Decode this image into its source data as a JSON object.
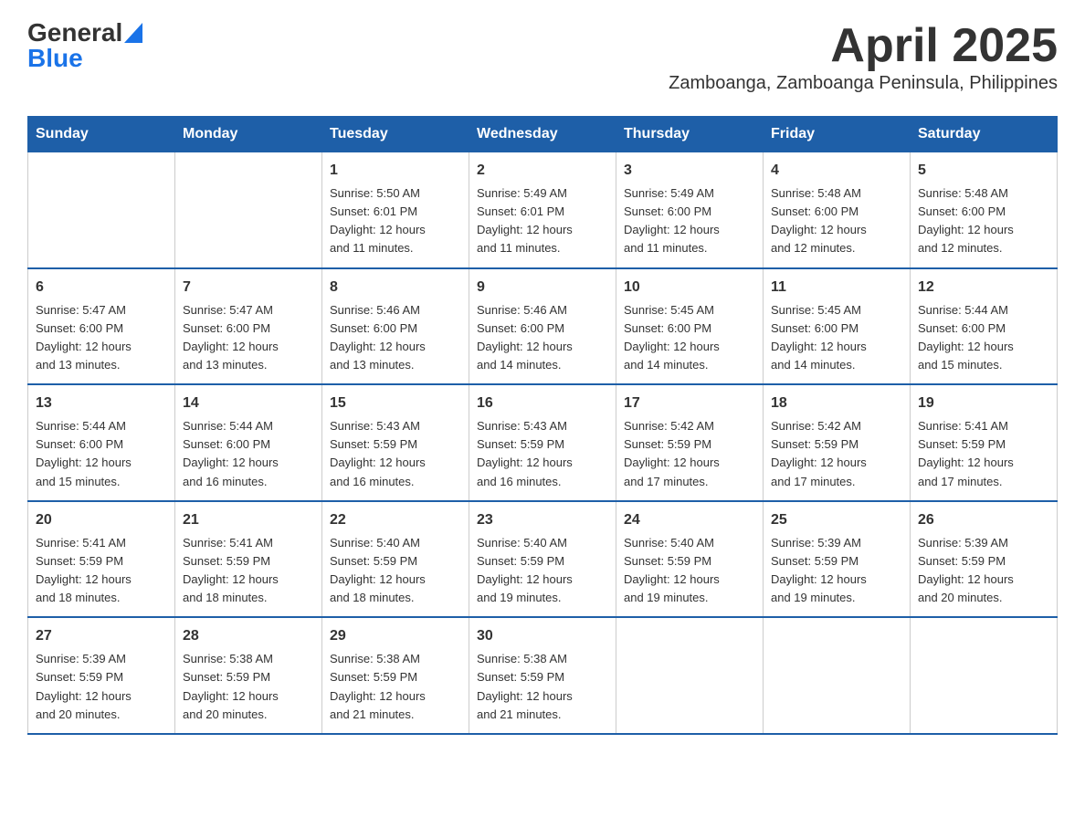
{
  "header": {
    "logo_general": "General",
    "logo_blue": "Blue",
    "title": "April 2025",
    "subtitle": "Zamboanga, Zamboanga Peninsula, Philippines"
  },
  "days_of_week": [
    "Sunday",
    "Monday",
    "Tuesday",
    "Wednesday",
    "Thursday",
    "Friday",
    "Saturday"
  ],
  "weeks": [
    [
      {
        "day": "",
        "info": ""
      },
      {
        "day": "",
        "info": ""
      },
      {
        "day": "1",
        "info": "Sunrise: 5:50 AM\nSunset: 6:01 PM\nDaylight: 12 hours\nand 11 minutes."
      },
      {
        "day": "2",
        "info": "Sunrise: 5:49 AM\nSunset: 6:01 PM\nDaylight: 12 hours\nand 11 minutes."
      },
      {
        "day": "3",
        "info": "Sunrise: 5:49 AM\nSunset: 6:00 PM\nDaylight: 12 hours\nand 11 minutes."
      },
      {
        "day": "4",
        "info": "Sunrise: 5:48 AM\nSunset: 6:00 PM\nDaylight: 12 hours\nand 12 minutes."
      },
      {
        "day": "5",
        "info": "Sunrise: 5:48 AM\nSunset: 6:00 PM\nDaylight: 12 hours\nand 12 minutes."
      }
    ],
    [
      {
        "day": "6",
        "info": "Sunrise: 5:47 AM\nSunset: 6:00 PM\nDaylight: 12 hours\nand 13 minutes."
      },
      {
        "day": "7",
        "info": "Sunrise: 5:47 AM\nSunset: 6:00 PM\nDaylight: 12 hours\nand 13 minutes."
      },
      {
        "day": "8",
        "info": "Sunrise: 5:46 AM\nSunset: 6:00 PM\nDaylight: 12 hours\nand 13 minutes."
      },
      {
        "day": "9",
        "info": "Sunrise: 5:46 AM\nSunset: 6:00 PM\nDaylight: 12 hours\nand 14 minutes."
      },
      {
        "day": "10",
        "info": "Sunrise: 5:45 AM\nSunset: 6:00 PM\nDaylight: 12 hours\nand 14 minutes."
      },
      {
        "day": "11",
        "info": "Sunrise: 5:45 AM\nSunset: 6:00 PM\nDaylight: 12 hours\nand 14 minutes."
      },
      {
        "day": "12",
        "info": "Sunrise: 5:44 AM\nSunset: 6:00 PM\nDaylight: 12 hours\nand 15 minutes."
      }
    ],
    [
      {
        "day": "13",
        "info": "Sunrise: 5:44 AM\nSunset: 6:00 PM\nDaylight: 12 hours\nand 15 minutes."
      },
      {
        "day": "14",
        "info": "Sunrise: 5:44 AM\nSunset: 6:00 PM\nDaylight: 12 hours\nand 16 minutes."
      },
      {
        "day": "15",
        "info": "Sunrise: 5:43 AM\nSunset: 5:59 PM\nDaylight: 12 hours\nand 16 minutes."
      },
      {
        "day": "16",
        "info": "Sunrise: 5:43 AM\nSunset: 5:59 PM\nDaylight: 12 hours\nand 16 minutes."
      },
      {
        "day": "17",
        "info": "Sunrise: 5:42 AM\nSunset: 5:59 PM\nDaylight: 12 hours\nand 17 minutes."
      },
      {
        "day": "18",
        "info": "Sunrise: 5:42 AM\nSunset: 5:59 PM\nDaylight: 12 hours\nand 17 minutes."
      },
      {
        "day": "19",
        "info": "Sunrise: 5:41 AM\nSunset: 5:59 PM\nDaylight: 12 hours\nand 17 minutes."
      }
    ],
    [
      {
        "day": "20",
        "info": "Sunrise: 5:41 AM\nSunset: 5:59 PM\nDaylight: 12 hours\nand 18 minutes."
      },
      {
        "day": "21",
        "info": "Sunrise: 5:41 AM\nSunset: 5:59 PM\nDaylight: 12 hours\nand 18 minutes."
      },
      {
        "day": "22",
        "info": "Sunrise: 5:40 AM\nSunset: 5:59 PM\nDaylight: 12 hours\nand 18 minutes."
      },
      {
        "day": "23",
        "info": "Sunrise: 5:40 AM\nSunset: 5:59 PM\nDaylight: 12 hours\nand 19 minutes."
      },
      {
        "day": "24",
        "info": "Sunrise: 5:40 AM\nSunset: 5:59 PM\nDaylight: 12 hours\nand 19 minutes."
      },
      {
        "day": "25",
        "info": "Sunrise: 5:39 AM\nSunset: 5:59 PM\nDaylight: 12 hours\nand 19 minutes."
      },
      {
        "day": "26",
        "info": "Sunrise: 5:39 AM\nSunset: 5:59 PM\nDaylight: 12 hours\nand 20 minutes."
      }
    ],
    [
      {
        "day": "27",
        "info": "Sunrise: 5:39 AM\nSunset: 5:59 PM\nDaylight: 12 hours\nand 20 minutes."
      },
      {
        "day": "28",
        "info": "Sunrise: 5:38 AM\nSunset: 5:59 PM\nDaylight: 12 hours\nand 20 minutes."
      },
      {
        "day": "29",
        "info": "Sunrise: 5:38 AM\nSunset: 5:59 PM\nDaylight: 12 hours\nand 21 minutes."
      },
      {
        "day": "30",
        "info": "Sunrise: 5:38 AM\nSunset: 5:59 PM\nDaylight: 12 hours\nand 21 minutes."
      },
      {
        "day": "",
        "info": ""
      },
      {
        "day": "",
        "info": ""
      },
      {
        "day": "",
        "info": ""
      }
    ]
  ]
}
